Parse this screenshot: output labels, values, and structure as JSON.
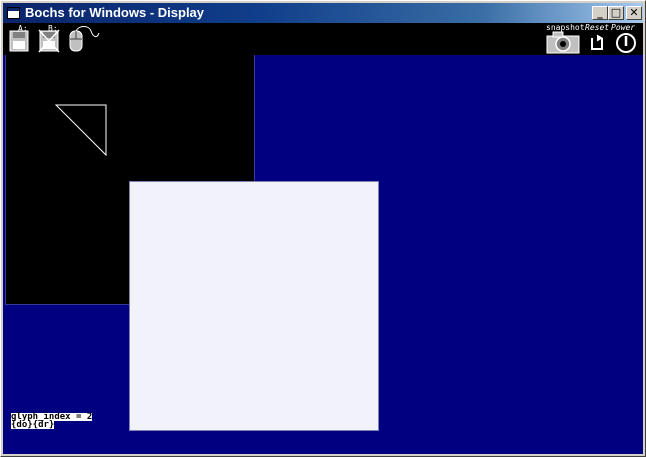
{
  "window": {
    "title": "Bochs for Windows - Display",
    "controls": {
      "minimize": "_",
      "maximize": "□",
      "close": "✕"
    }
  },
  "toolbar": {
    "floppy_a_label": "A:",
    "floppy_b_label": "B:",
    "snapshot_label": "snapshot",
    "reset_label": "Reset",
    "power_label": "Power"
  },
  "display": {
    "console_line1": "glyph_index = 2",
    "console_line2": "{do}{dr}"
  },
  "colors": {
    "display_bg": "#000080",
    "titlebar": "#0a246a",
    "white_window": "#f2f2fb"
  }
}
